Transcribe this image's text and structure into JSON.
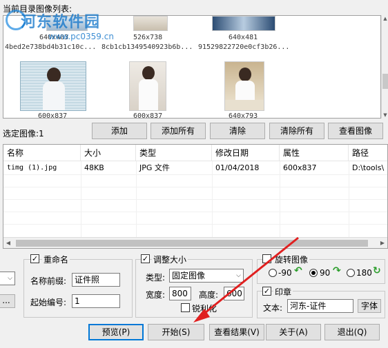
{
  "watermark": {
    "text": "河东软件园",
    "url": "www.pc0359.cn"
  },
  "thumbnails": {
    "label": "当前目录图像列表:",
    "row1": [
      {
        "size": "640x403",
        "hash": "4bed2e738bd4b31c10c..."
      },
      {
        "size": "526x738",
        "hash": "8cb1cb1349540923b6b..."
      },
      {
        "size": "640x481",
        "hash": "91529822720e0cf3b26..."
      }
    ],
    "row2": [
      {
        "size": "600x837"
      },
      {
        "size": "600x837"
      },
      {
        "size": "640x793"
      }
    ]
  },
  "selected": {
    "label": "选定图像:1",
    "buttons": {
      "add": "添加",
      "add_all": "添加所有",
      "clear": "清除",
      "clear_all": "清除所有",
      "view": "查看图像"
    }
  },
  "filelist": {
    "columns": [
      "名称",
      "大小",
      "类型",
      "修改日期",
      "属性",
      "路径"
    ],
    "rows": [
      {
        "name": "timg (1).jpg",
        "size": "48KB",
        "type": "JPG 文件",
        "date": "01/04/2018",
        "attr": "600x837",
        "path": "D:\\tools\\"
      }
    ]
  },
  "rename": {
    "title": "重命名",
    "prefix_label": "名称前缀:",
    "prefix_value": "证件照",
    "start_label": "起始编号:",
    "start_value": "1"
  },
  "resize": {
    "title": "调整大小",
    "type_label": "类型:",
    "type_value": "固定图像",
    "width_label": "宽度:",
    "width_value": "800",
    "height_label": "高度:",
    "height_value": "600",
    "sharpen_label": "锐利化"
  },
  "rotate": {
    "title": "旋转图像",
    "options": [
      "-90",
      "90",
      "180"
    ],
    "selected": "90"
  },
  "stamp": {
    "title": "印章",
    "text_label": "文本:",
    "text_value": "河东-证件",
    "font_button": "字体"
  },
  "left_controls": {
    "ellipsis": "..."
  },
  "footer": {
    "preview": "预览(P)",
    "start": "开始(S)",
    "view_result": "查看结果(V)",
    "about": "关于(A)",
    "exit": "退出(Q)"
  },
  "colors": {
    "accent": "#0078d7",
    "arrow": "#e02020",
    "watermark": "#0e73c9"
  }
}
